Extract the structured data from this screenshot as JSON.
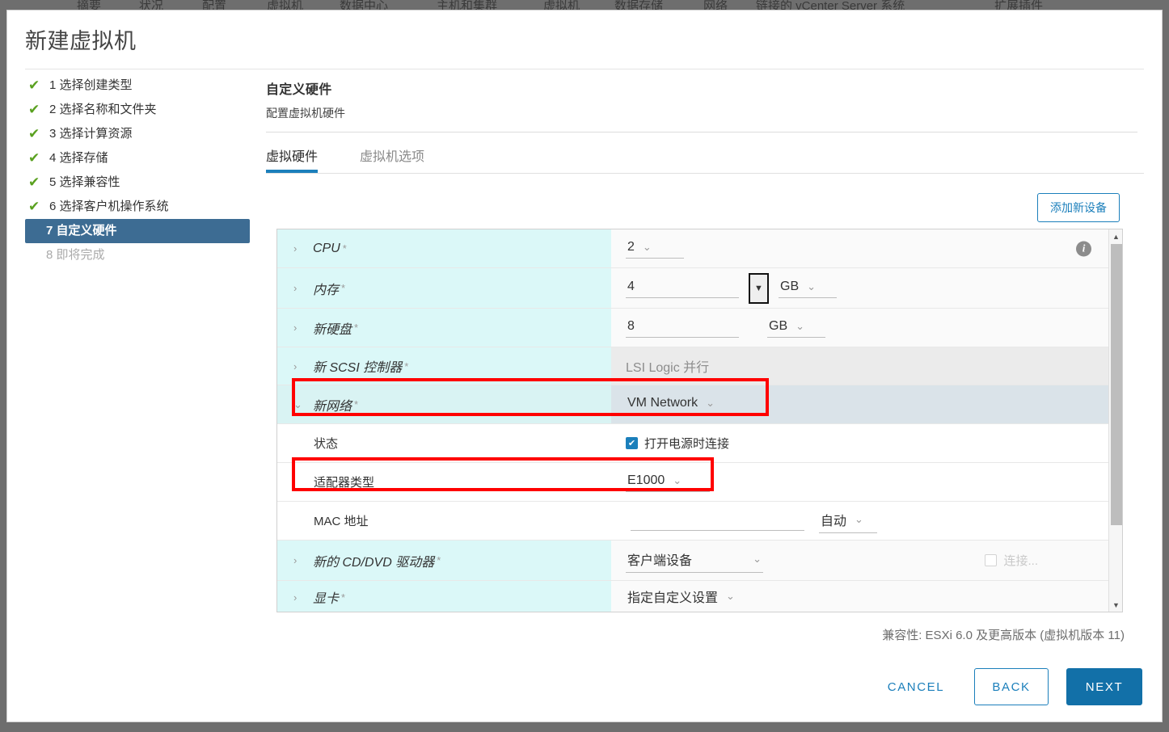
{
  "background_menu": {
    "items": [
      "摘要",
      "状况",
      "配置",
      "虚拟机",
      "数据中心",
      "主机和集群",
      "虚拟机",
      "数据存储",
      "网络",
      "链接的 vCenter Server 系统",
      "扩展插件"
    ]
  },
  "dialog": {
    "title": "新建虚拟机"
  },
  "steps": [
    {
      "num": "1",
      "label": "选择创建类型",
      "state": "done",
      "check": "✔"
    },
    {
      "num": "2",
      "label": "选择名称和文件夹",
      "state": "done",
      "check": "✔"
    },
    {
      "num": "3",
      "label": "选择计算资源",
      "state": "done",
      "check": "✔"
    },
    {
      "num": "4",
      "label": "选择存储",
      "state": "done",
      "check": "✔"
    },
    {
      "num": "5",
      "label": "选择兼容性",
      "state": "done",
      "check": "✔"
    },
    {
      "num": "6",
      "label": "选择客户机操作系统",
      "state": "done",
      "check": "✔"
    },
    {
      "num": "7",
      "label": "自定义硬件",
      "state": "current",
      "check": ""
    },
    {
      "num": "8",
      "label": "即将完成",
      "state": "disabled",
      "check": ""
    }
  ],
  "step_text": {
    "s1": "1 选择创建类型",
    "s2": "2 选择名称和文件夹",
    "s3": "3 选择计算资源",
    "s4": "4 选择存储",
    "s5": "5 选择兼容性",
    "s6": "6 选择客户机操作系统",
    "s7": "7 自定义硬件",
    "s8": "8 即将完成"
  },
  "pane": {
    "heading": "自定义硬件",
    "subheading": "配置虚拟机硬件",
    "tabs": [
      {
        "label": "虚拟硬件",
        "active": true
      },
      {
        "label": "虚拟机选项",
        "active": false
      }
    ],
    "tab_hardware": "虚拟硬件",
    "tab_options": "虚拟机选项",
    "add_device_label": "添加新设备"
  },
  "hardware_rows": [
    {
      "label": "CPU",
      "required": "*",
      "caret": "›",
      "type": "device",
      "value": "2",
      "control": "select",
      "info": true
    },
    {
      "label": "内存",
      "required": "*",
      "caret": "›",
      "type": "device",
      "value": "4",
      "unit": "GB",
      "control": "text-unit",
      "spinner": true
    },
    {
      "label": "新硬盘",
      "required": "*",
      "caret": "›",
      "type": "device",
      "value": "8",
      "unit": "GB",
      "control": "text-unit"
    },
    {
      "label": "新 SCSI 控制器",
      "required": "*",
      "caret": "›",
      "type": "device",
      "value": "LSI Logic 并行",
      "control": "static",
      "disabled": true
    },
    {
      "label": "新网络",
      "required": "*",
      "caret": "⌄",
      "type": "device",
      "value": "VM Network",
      "control": "select",
      "selected": true
    },
    {
      "label": "状态",
      "type": "sub",
      "control": "checkbox",
      "checkbox_checked": true,
      "checkbox_label": "打开电源时连接"
    },
    {
      "label": "适配器类型",
      "type": "sub",
      "control": "select",
      "value": "E1000"
    },
    {
      "label": "MAC 地址",
      "type": "sub",
      "control": "text-select",
      "value": "",
      "mode": "自动"
    },
    {
      "label": "新的 CD/DVD 驱动器",
      "required": "*",
      "caret": "›",
      "type": "device",
      "value": "客户端设备",
      "control": "select",
      "checkbox_checked": false,
      "checkbox_label": "连接..."
    },
    {
      "label": "显卡",
      "required": "*",
      "caret": "›",
      "type": "device",
      "value": "指定自定义设置",
      "control": "select"
    }
  ],
  "rows": {
    "cpu": {
      "label": "CPU",
      "req": "*",
      "caret": "›",
      "value": "2"
    },
    "memory": {
      "label": "内存",
      "req": "*",
      "caret": "›",
      "value": "4",
      "unit": "GB",
      "spinner_glyph": "▼"
    },
    "disk": {
      "label": "新硬盘",
      "req": "*",
      "caret": "›",
      "value": "8",
      "unit": "GB"
    },
    "scsi": {
      "label": "新 SCSI 控制器",
      "req": "*",
      "caret": "›",
      "value": "LSI Logic 并行"
    },
    "network": {
      "label": "新网络",
      "req": "*",
      "caret": "⌄",
      "value": "VM Network"
    },
    "status": {
      "label": "状态",
      "checkbox_label": "打开电源时连接",
      "check_glyph": "✔"
    },
    "adapter": {
      "label": "适配器类型",
      "value": "E1000"
    },
    "mac": {
      "label": "MAC 地址",
      "value": "",
      "mode": "自动"
    },
    "cddvd": {
      "label": "新的 CD/DVD 驱动器",
      "req": "*",
      "caret": "›",
      "value": "客户端设备",
      "checkbox_label": "连接..."
    },
    "video": {
      "label": "显卡",
      "req": "*",
      "caret": "›",
      "value": "指定自定义设置"
    }
  },
  "icons": {
    "chevron_down": "⌄",
    "chevron_right": "›",
    "info": "i",
    "scroll_up": "▲",
    "scroll_down": "▼"
  },
  "compatibility": "兼容性: ESXi 6.0 及更高版本 (虚拟机版本 11)",
  "footer": {
    "cancel": "CANCEL",
    "back": "BACK",
    "next": "NEXT"
  },
  "colors": {
    "accent": "#1b7fbb",
    "primary_button": "#1270a8",
    "step_current": "#3d6c93",
    "check_green": "#5aa120",
    "label_cell": "#dbf8f8",
    "selected_row": "#dae3e9",
    "annotation": "#ff0000"
  }
}
